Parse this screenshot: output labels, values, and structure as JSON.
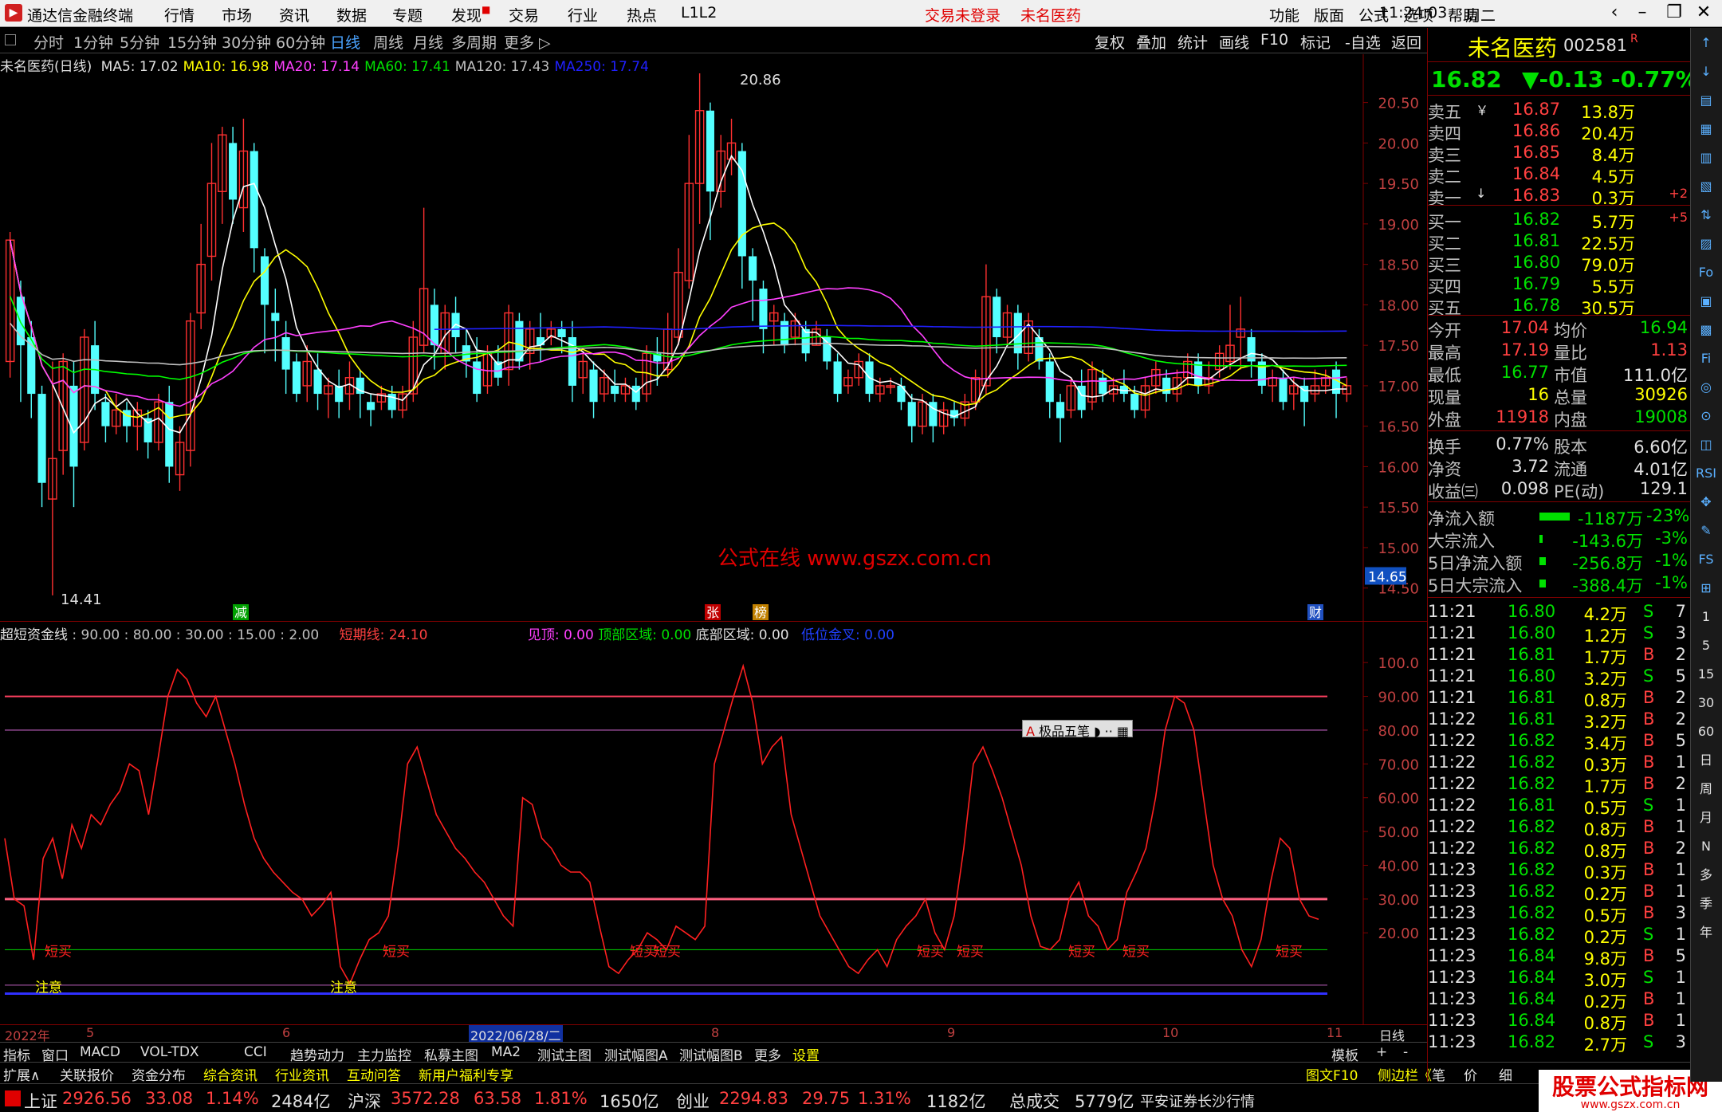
{
  "titlebar": {
    "app_name": "通达信金融终端",
    "menus": [
      "行情",
      "市场",
      "资讯",
      "数据",
      "专题",
      "发现",
      "交易",
      "行业",
      "热点",
      "L1L2"
    ],
    "status_login": "交易未登录",
    "stock_title": "未名医药",
    "right_menus": [
      "功能",
      "版面",
      "公式",
      "选项",
      "帮助"
    ],
    "time": "11:24:03",
    "weekday": "周二"
  },
  "periods": [
    "分时",
    "1分钟",
    "5分钟",
    "15分钟",
    "30分钟",
    "60分钟",
    "日线",
    "周线",
    "月线",
    "多周期",
    "更多"
  ],
  "active_period": "日线",
  "toolbar": [
    "复权",
    "叠加",
    "统计",
    "画线",
    "F10",
    "标记",
    "-自选",
    "返回"
  ],
  "main_info": {
    "stock": "未名医药(日线)",
    "ma5": "MA5: 17.02",
    "ma10": "MA10: 16.98",
    "ma20": "MA20: 17.14",
    "ma60": "MA60: 17.41",
    "ma120": "MA120: 17.43",
    "ma250": "MA250: 17.74"
  },
  "price_axis": [
    "20.50",
    "20.00",
    "19.50",
    "19.00",
    "18.50",
    "18.00",
    "17.50",
    "17.00",
    "16.50",
    "16.00",
    "15.50",
    "15.00",
    "14.50"
  ],
  "price_marker": "14.65",
  "chart_labels": {
    "high": "20.86",
    "low": "14.41",
    "flags": [
      "减",
      "张",
      "榜",
      "财"
    ]
  },
  "watermark": "公式在线  www.gszx.com.cn",
  "indicator": {
    "name": "超短资金线",
    "params": ": 90.00 : 80.00 : 30.00 : 15.00 : 2.00",
    "short_line": "短期线: 24.10",
    "top_signal": "见顶: 0.00",
    "top_zone": "顶部区域: 0.00",
    "bottom_zone": "底部区域: 0.00",
    "low_cross": "低位金叉: 0.00",
    "axis": [
      "100.0",
      "90.00",
      "80.00",
      "70.00",
      "60.00",
      "50.00",
      "40.00",
      "30.00",
      "20.00"
    ],
    "signal_low": "短买",
    "signal_note": "注意",
    "ime": "极品五笔"
  },
  "date_axis": [
    "2022年",
    "5",
    "6",
    "2022/06/28/二",
    "8",
    "9",
    "10",
    "11"
  ],
  "date_unit": "日线",
  "tabs": [
    "指标",
    "窗口",
    "MACD",
    "VOL-TDX",
    "CCI",
    "趋势动力",
    "主力监控",
    "私募主图",
    "MA2",
    "测试主图",
    "测试幅图A",
    "测试幅图B",
    "更多",
    "设置"
  ],
  "tabs_right": [
    "模板",
    "+",
    "-"
  ],
  "tabs2": [
    "扩展∧",
    "关联报价",
    "资金分布",
    "综合资讯",
    "行业资讯",
    "互动问答",
    "新用户福利专享"
  ],
  "tabs2_right": [
    "图文F10",
    "侧边栏《",
    "笔",
    "价",
    "细"
  ],
  "statusbar": {
    "sh": {
      "name": "上证",
      "value": "2926.56",
      "chg": "33.08",
      "pct": "1.14%",
      "amt": "2484亿"
    },
    "sz": {
      "name": "沪深",
      "value": "3572.28",
      "chg": "63.58",
      "pct": "1.81%",
      "amt": "1650亿"
    },
    "cy": {
      "name": "创业",
      "value": "2294.83",
      "chg": "29.75",
      "pct": "1.31%",
      "amt": "1182亿"
    },
    "total": {
      "name": "总成交",
      "amt": "5779亿"
    },
    "broker": "平安证券长沙行情",
    "brand": "股票公式指标网",
    "brand_url": "www.gszx.com.cn"
  },
  "quote": {
    "name": "未名医药",
    "code": "002581",
    "badge": "R",
    "price": "16.82",
    "change": "▼-0.13",
    "pct": "-0.77%",
    "asks": [
      {
        "label": "卖五",
        "mark": "￥",
        "price": "16.87",
        "vol": "13.8万",
        "chg": ""
      },
      {
        "label": "卖四",
        "mark": "",
        "price": "16.86",
        "vol": "20.4万",
        "chg": ""
      },
      {
        "label": "卖三",
        "mark": "",
        "price": "16.85",
        "vol": "8.4万",
        "chg": ""
      },
      {
        "label": "卖二",
        "mark": "",
        "price": "16.84",
        "vol": "4.5万",
        "chg": ""
      },
      {
        "label": "卖一",
        "mark": "↓",
        "price": "16.83",
        "vol": "0.3万",
        "chg": "+2"
      }
    ],
    "bids": [
      {
        "label": "买一",
        "price": "16.82",
        "vol": "5.7万",
        "chg": "+5"
      },
      {
        "label": "买二",
        "price": "16.81",
        "vol": "22.5万",
        "chg": ""
      },
      {
        "label": "买三",
        "price": "16.80",
        "vol": "79.0万",
        "chg": ""
      },
      {
        "label": "买四",
        "price": "16.79",
        "vol": "5.5万",
        "chg": ""
      },
      {
        "label": "买五",
        "price": "16.78",
        "vol": "30.5万",
        "chg": ""
      }
    ],
    "stats": [
      {
        "l1": "今开",
        "v1": "17.04",
        "c1": "red",
        "l2": "均价",
        "v2": "16.94",
        "c2": "grn"
      },
      {
        "l1": "最高",
        "v1": "17.19",
        "c1": "red",
        "l2": "量比",
        "v2": "1.13",
        "c2": "red"
      },
      {
        "l1": "最低",
        "v1": "16.77",
        "c1": "grn",
        "l2": "市值",
        "v2": "111.0亿",
        "c2": "wht"
      },
      {
        "l1": "现量",
        "v1": "16",
        "c1": "yel",
        "l2": "总量",
        "v2": "30926",
        "c2": "yel"
      },
      {
        "l1": "外盘",
        "v1": "11918",
        "c1": "red",
        "l2": "内盘",
        "v2": "19008",
        "c2": "grn"
      }
    ],
    "stats2": [
      {
        "l1": "换手",
        "v1": "0.77%",
        "l2": "股本",
        "v2": "6.60亿"
      },
      {
        "l1": "净资",
        "v1": "3.72",
        "l2": "流通",
        "v2": "4.01亿"
      },
      {
        "l1": "收益㈢",
        "v1": "0.098",
        "l2": "PE(动)",
        "v2": "129.1"
      }
    ],
    "flows": [
      {
        "label": "净流入额",
        "value": "-1187万",
        "pct": "-23%"
      },
      {
        "label": "大宗流入",
        "value": "-143.6万",
        "pct": "-3%"
      },
      {
        "label": "5日净流入额",
        "value": "-256.8万",
        "pct": "-1%"
      },
      {
        "label": "5日大宗流入",
        "value": "-388.4万",
        "pct": "-1%"
      }
    ],
    "ticks": [
      [
        "11:21",
        "16.80",
        "4.2万",
        "S",
        "7"
      ],
      [
        "11:21",
        "16.80",
        "1.2万",
        "S",
        "3"
      ],
      [
        "11:21",
        "16.81",
        "1.7万",
        "B",
        "2"
      ],
      [
        "11:21",
        "16.80",
        "3.2万",
        "S",
        "5"
      ],
      [
        "11:21",
        "16.81",
        "0.8万",
        "B",
        "2"
      ],
      [
        "11:22",
        "16.81",
        "3.2万",
        "B",
        "2"
      ],
      [
        "11:22",
        "16.82",
        "3.4万",
        "B",
        "5"
      ],
      [
        "11:22",
        "16.82",
        "0.3万",
        "B",
        "1"
      ],
      [
        "11:22",
        "16.82",
        "1.7万",
        "B",
        "2"
      ],
      [
        "11:22",
        "16.81",
        "0.5万",
        "S",
        "1"
      ],
      [
        "11:22",
        "16.82",
        "0.8万",
        "B",
        "1"
      ],
      [
        "11:22",
        "16.82",
        "0.8万",
        "B",
        "2"
      ],
      [
        "11:23",
        "16.82",
        "0.3万",
        "B",
        "1"
      ],
      [
        "11:23",
        "16.82",
        "0.2万",
        "B",
        "1"
      ],
      [
        "11:23",
        "16.82",
        "0.5万",
        "B",
        "3"
      ],
      [
        "11:23",
        "16.82",
        "0.2万",
        "S",
        "1"
      ],
      [
        "11:23",
        "16.84",
        "9.8万",
        "B",
        "5"
      ],
      [
        "11:23",
        "16.84",
        "3.0万",
        "S",
        "1"
      ],
      [
        "11:23",
        "16.84",
        "0.2万",
        "B",
        "1"
      ],
      [
        "11:23",
        "16.84",
        "0.8万",
        "B",
        "1"
      ],
      [
        "11:23",
        "16.82",
        "2.7万",
        "S",
        "3"
      ]
    ]
  },
  "rtools": [
    "↑",
    "↓",
    "▤",
    "▦",
    "▥",
    "▧",
    "⇅",
    "▨",
    "Fo",
    "▣",
    "▩",
    "Fi",
    "◎",
    "⊙",
    "◫",
    "RSI",
    "✥",
    "✎",
    "FS",
    "⊞",
    "1",
    "5",
    "15",
    "30",
    "60",
    "日",
    "周",
    "月",
    "N",
    "多",
    "季",
    "年"
  ],
  "chart_data": {
    "type": "candlestick",
    "ylim": [
      14.3,
      20.9
    ],
    "candles": [
      [
        17.3,
        18.8,
        18.9,
        17.1
      ],
      [
        18.1,
        17.5,
        18.3,
        16.8
      ],
      [
        17.6,
        16.9,
        17.8,
        16.6
      ],
      [
        16.9,
        15.8,
        17.0,
        15.5
      ],
      [
        15.6,
        16.1,
        17.3,
        14.41
      ],
      [
        16.2,
        17.3,
        17.4,
        15.9
      ],
      [
        17.0,
        16.0,
        17.3,
        15.5
      ],
      [
        16.3,
        17.6,
        17.7,
        16.2
      ],
      [
        17.5,
        16.9,
        17.8,
        16.7
      ],
      [
        16.8,
        16.5,
        16.9,
        16.3
      ],
      [
        16.5,
        16.7,
        16.9,
        16.4
      ],
      [
        16.7,
        16.5,
        16.8,
        16.3
      ],
      [
        16.5,
        16.7,
        16.8,
        16.2
      ],
      [
        16.6,
        16.3,
        16.7,
        16.1
      ],
      [
        16.3,
        16.8,
        16.9,
        16.2
      ],
      [
        16.8,
        16.0,
        17.0,
        15.8
      ],
      [
        15.9,
        16.3,
        16.5,
        15.7
      ],
      [
        16.2,
        17.8,
        17.9,
        16.0
      ],
      [
        17.9,
        18.5,
        19.0,
        17.7
      ],
      [
        18.6,
        19.5,
        20.0,
        18.3
      ],
      [
        19.4,
        20.1,
        20.2,
        19.0
      ],
      [
        20.0,
        19.3,
        20.2,
        19.0
      ],
      [
        19.2,
        19.9,
        20.3,
        18.9
      ],
      [
        19.9,
        18.7,
        20.0,
        18.4
      ],
      [
        18.6,
        18.0,
        18.7,
        17.4
      ],
      [
        17.9,
        17.8,
        18.2,
        17.3
      ],
      [
        17.6,
        17.2,
        17.8,
        16.9
      ],
      [
        17.3,
        16.9,
        17.4,
        16.8
      ],
      [
        17.0,
        17.3,
        17.5,
        16.8
      ],
      [
        17.2,
        16.9,
        17.4,
        16.7
      ],
      [
        16.9,
        17.0,
        17.1,
        16.6
      ],
      [
        17.0,
        16.8,
        17.2,
        16.6
      ],
      [
        16.9,
        17.1,
        17.3,
        16.7
      ],
      [
        17.1,
        16.9,
        17.2,
        16.6
      ],
      [
        16.8,
        16.7,
        16.9,
        16.5
      ],
      [
        16.8,
        16.9,
        17.0,
        16.7
      ],
      [
        16.9,
        16.7,
        17.0,
        16.6
      ],
      [
        16.7,
        16.9,
        17.0,
        16.6
      ],
      [
        16.9,
        17.6,
        17.8,
        16.8
      ],
      [
        17.5,
        18.2,
        19.2,
        17.4
      ],
      [
        18.0,
        17.5,
        18.2,
        17.2
      ],
      [
        17.4,
        17.9,
        18.0,
        17.2
      ],
      [
        17.9,
        17.6,
        18.1,
        17.4
      ],
      [
        17.5,
        17.3,
        17.7,
        17.1
      ],
      [
        17.3,
        16.9,
        17.6,
        16.8
      ],
      [
        17.0,
        17.4,
        17.5,
        16.9
      ],
      [
        17.3,
        17.1,
        17.5,
        17.0
      ],
      [
        17.2,
        17.9,
        18.0,
        17.0
      ],
      [
        17.8,
        17.3,
        17.9,
        17.2
      ],
      [
        17.4,
        17.7,
        17.8,
        17.2
      ],
      [
        17.6,
        17.5,
        17.9,
        17.3
      ],
      [
        17.6,
        17.7,
        17.8,
        17.5
      ],
      [
        17.7,
        17.6,
        17.8,
        17.4
      ],
      [
        17.6,
        17.0,
        17.8,
        16.8
      ],
      [
        17.1,
        17.3,
        17.4,
        16.9
      ],
      [
        17.2,
        16.8,
        17.3,
        16.6
      ],
      [
        16.9,
        17.1,
        17.2,
        16.8
      ],
      [
        17.0,
        16.9,
        17.2,
        16.8
      ],
      [
        16.9,
        17.0,
        17.1,
        16.8
      ],
      [
        17.0,
        16.8,
        17.1,
        16.7
      ],
      [
        16.9,
        17.4,
        17.5,
        16.8
      ],
      [
        17.4,
        17.3,
        17.6,
        17.0
      ],
      [
        17.2,
        17.7,
        17.9,
        17.1
      ],
      [
        17.6,
        18.4,
        18.7,
        17.5
      ],
      [
        18.3,
        19.5,
        20.1,
        18.2
      ],
      [
        19.5,
        20.4,
        20.86,
        19.0
      ],
      [
        20.4,
        19.4,
        20.5,
        18.8
      ],
      [
        19.4,
        19.9,
        20.1,
        19.2
      ],
      [
        19.8,
        20.0,
        20.3,
        19.6
      ],
      [
        19.9,
        18.6,
        20.0,
        18.2
      ],
      [
        18.6,
        18.3,
        18.7,
        17.8
      ],
      [
        18.2,
        17.7,
        18.3,
        17.4
      ],
      [
        17.8,
        17.9,
        18.0,
        17.5
      ],
      [
        17.8,
        17.5,
        17.9,
        17.4
      ],
      [
        17.6,
        17.8,
        17.9,
        17.5
      ],
      [
        17.7,
        17.4,
        17.8,
        17.3
      ],
      [
        17.5,
        17.7,
        17.8,
        17.5
      ],
      [
        17.6,
        17.3,
        17.7,
        17.2
      ],
      [
        17.3,
        16.9,
        17.4,
        16.8
      ],
      [
        17.0,
        17.1,
        17.2,
        16.9
      ],
      [
        17.1,
        17.3,
        17.4,
        17.0
      ],
      [
        17.3,
        16.9,
        17.4,
        16.8
      ],
      [
        16.9,
        17.0,
        17.1,
        16.8
      ],
      [
        17.0,
        17.0,
        17.1,
        16.9
      ],
      [
        17.0,
        16.8,
        17.1,
        16.7
      ],
      [
        16.8,
        16.5,
        16.9,
        16.3
      ],
      [
        16.5,
        16.8,
        16.9,
        16.4
      ],
      [
        16.8,
        16.5,
        16.9,
        16.3
      ],
      [
        16.5,
        16.7,
        16.8,
        16.4
      ],
      [
        16.7,
        16.6,
        16.8,
        16.5
      ],
      [
        16.6,
        16.8,
        16.9,
        16.5
      ],
      [
        16.8,
        17.1,
        17.2,
        16.7
      ],
      [
        17.0,
        18.1,
        18.5,
        16.9
      ],
      [
        18.1,
        17.6,
        18.2,
        17.4
      ],
      [
        17.6,
        17.9,
        18.0,
        17.5
      ],
      [
        17.9,
        17.4,
        18.0,
        17.2
      ],
      [
        17.4,
        17.8,
        17.9,
        17.3
      ],
      [
        17.6,
        17.3,
        17.7,
        17.2
      ],
      [
        17.3,
        16.8,
        17.4,
        16.6
      ],
      [
        16.8,
        16.6,
        16.9,
        16.3
      ],
      [
        16.7,
        17.0,
        17.1,
        16.6
      ],
      [
        17.0,
        16.7,
        17.2,
        16.6
      ],
      [
        16.8,
        17.2,
        17.3,
        16.7
      ],
      [
        17.1,
        16.9,
        17.2,
        16.8
      ],
      [
        16.9,
        17.0,
        17.1,
        16.8
      ],
      [
        17.0,
        16.9,
        17.2,
        16.8
      ],
      [
        16.9,
        16.7,
        17.0,
        16.6
      ],
      [
        16.7,
        17.0,
        17.1,
        16.6
      ],
      [
        17.0,
        17.2,
        17.3,
        16.9
      ],
      [
        17.1,
        16.9,
        17.2,
        16.8
      ],
      [
        16.9,
        17.1,
        17.2,
        16.8
      ],
      [
        17.1,
        17.3,
        17.4,
        17.0
      ],
      [
        17.3,
        17.0,
        17.4,
        16.9
      ],
      [
        17.0,
        17.1,
        17.3,
        16.9
      ],
      [
        17.2,
        17.4,
        17.5,
        17.1
      ],
      [
        17.3,
        17.5,
        18.0,
        17.2
      ],
      [
        17.6,
        17.7,
        18.1,
        17.2
      ],
      [
        17.6,
        17.3,
        17.7,
        17.1
      ],
      [
        17.3,
        17.0,
        17.4,
        16.9
      ],
      [
        17.0,
        17.1,
        17.2,
        16.8
      ],
      [
        17.1,
        16.8,
        17.2,
        16.7
      ],
      [
        16.9,
        17.0,
        17.1,
        16.7
      ],
      [
        17.0,
        16.8,
        17.1,
        16.5
      ],
      [
        16.9,
        17.0,
        17.2,
        16.8
      ],
      [
        17.0,
        17.1,
        17.2,
        16.9
      ],
      [
        17.2,
        16.9,
        17.3,
        16.6
      ],
      [
        16.9,
        17.0,
        17.1,
        16.8
      ]
    ],
    "ma_series": [
      {
        "name": "MA5",
        "color": "#ffffff"
      },
      {
        "name": "MA10",
        "color": "#ffff00"
      },
      {
        "name": "MA20",
        "color": "#ff40ff"
      },
      {
        "name": "MA60",
        "color": "#00ff00"
      },
      {
        "name": "MA120",
        "color": "#c0c0c0"
      },
      {
        "name": "MA250",
        "color": "#2020ff"
      }
    ],
    "indicator_values": [
      48,
      30,
      28,
      12,
      42,
      48,
      36,
      52,
      45,
      55,
      52,
      58,
      62,
      70,
      68,
      55,
      72,
      90,
      98,
      95,
      88,
      84,
      90,
      80,
      70,
      58,
      48,
      42,
      38,
      35,
      32,
      30,
      25,
      28,
      32,
      10,
      5,
      12,
      18,
      20,
      25,
      45,
      70,
      75,
      65,
      55,
      50,
      45,
      42,
      38,
      35,
      30,
      25,
      22,
      60,
      58,
      48,
      45,
      40,
      38,
      38,
      35,
      22,
      10,
      8,
      12,
      15,
      20,
      18,
      15,
      22,
      20,
      18,
      22,
      70,
      80,
      90,
      99,
      88,
      70,
      75,
      78,
      55,
      45,
      35,
      25,
      20,
      15,
      10,
      8,
      12,
      15,
      10,
      18,
      22,
      25,
      30,
      20,
      15,
      25,
      45,
      70,
      75,
      68,
      60,
      50,
      40,
      25,
      16,
      15,
      18,
      30,
      35,
      25,
      22,
      15,
      18,
      32,
      38,
      45,
      60,
      80,
      90,
      88,
      80,
      60,
      40,
      30,
      25,
      15,
      10,
      18,
      35,
      48,
      45,
      30,
      25,
      24
    ]
  }
}
